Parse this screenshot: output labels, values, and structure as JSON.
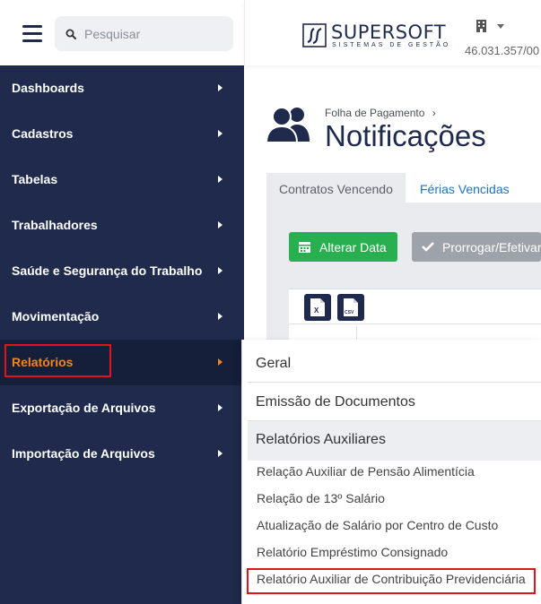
{
  "search": {
    "placeholder": "Pesquisar"
  },
  "brand": {
    "name": "SUPERSOFT",
    "tagline": "SISTEMAS DE GESTÃO"
  },
  "company": {
    "cnpj": "46.031.357/00"
  },
  "sidebar": {
    "items": [
      {
        "label": "Dashboards"
      },
      {
        "label": "Cadastros"
      },
      {
        "label": "Tabelas"
      },
      {
        "label": "Trabalhadores"
      },
      {
        "label": "Saúde e Segurança do Trabalho"
      },
      {
        "label": "Movimentação"
      },
      {
        "label": "Relatórios",
        "active": true
      },
      {
        "label": "Exportação de Arquivos"
      },
      {
        "label": "Importação de Arquivos"
      }
    ]
  },
  "page": {
    "breadcrumb": "Folha de Pagamento",
    "breadcrumb_sep": "›",
    "title": "Notificações"
  },
  "tabs": [
    {
      "label": "Contratos Vencendo",
      "active": true
    },
    {
      "label": "Férias Vencidas",
      "active": false
    }
  ],
  "actions": {
    "change_date": "Alterar Data",
    "extend": "Prorrogar/Efetivar"
  },
  "export": {
    "excel_label": "X",
    "csv_label": "CSV"
  },
  "reports_menu": {
    "sections": [
      {
        "label": "Geral"
      },
      {
        "label": "Emissão de Documentos"
      },
      {
        "label": "Relatórios Auxiliares",
        "expanded": true
      }
    ],
    "items": [
      {
        "label": "Relação Auxiliar de Pensão Alimentícia"
      },
      {
        "label": "Relação de 13º Salário"
      },
      {
        "label": "Atualização de Salário por Centro de Custo"
      },
      {
        "label": "Relatório Empréstimo Consignado"
      },
      {
        "label": "Relatório Auxiliar de Contribuição Previdenciária",
        "highlighted": true
      }
    ]
  },
  "colors": {
    "sidebar_bg": "#1f2a4d",
    "active_text": "#ee8424",
    "highlight_border": "#e3131b",
    "success_button": "#28b050",
    "link_blue": "#1a73c9"
  }
}
